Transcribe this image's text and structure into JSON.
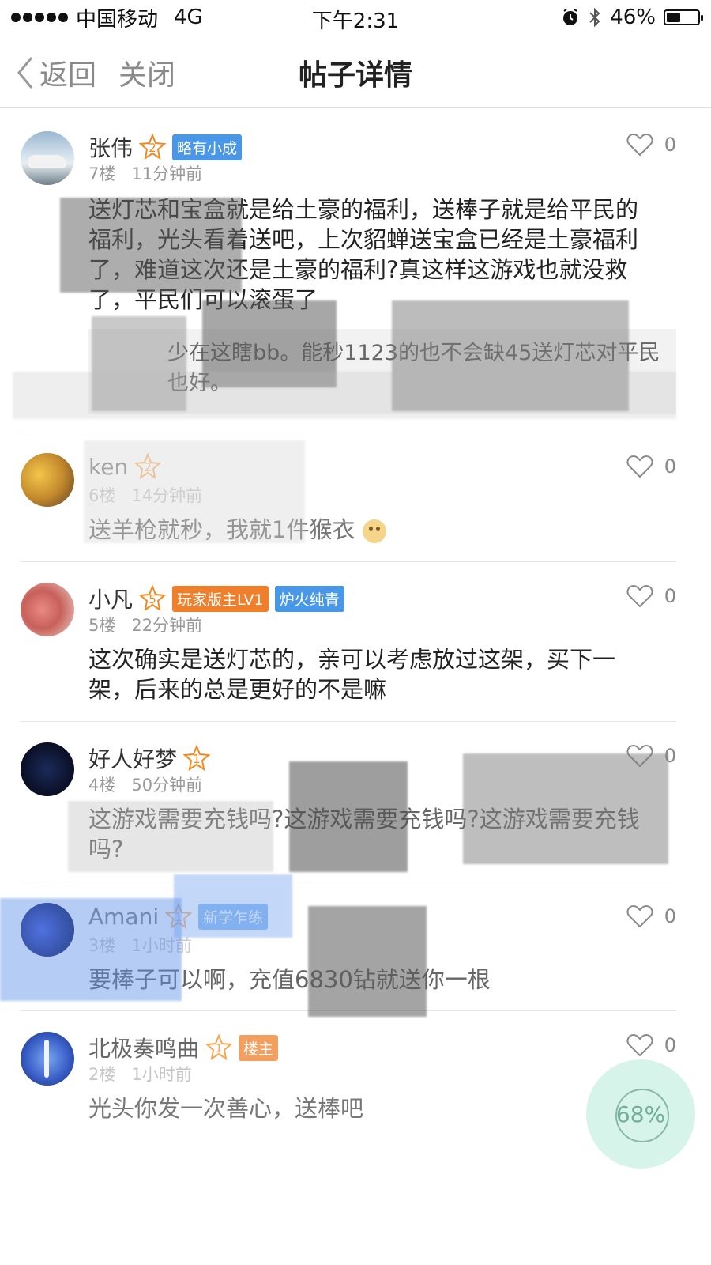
{
  "status_bar": {
    "carrier": "中国移动",
    "network": "4G",
    "time": "下午2:31",
    "battery_percent": "46%",
    "battery_level": 0.46
  },
  "nav": {
    "back_label": "返回",
    "close_label": "关闭",
    "title": "帖子详情"
  },
  "colors": {
    "accent_orange": "#f07f2b",
    "badge_blue": "#4a97e8",
    "float_button": "#c8f0e1"
  },
  "comments": [
    {
      "username": "张伟",
      "level": "2",
      "badges": [
        "略有小成"
      ],
      "floor": "7楼",
      "time": "11分钟前",
      "likes": "0",
      "content": "送灯芯和宝盒就是给土豪的福利，送棒子就是给平民的福利，光头看着送吧，上次貂蝉送宝盒已经是土豪福利了，难道这次还是土豪的福利?真这样这游戏也就没救了，平民们可以滚蛋了",
      "quote": "少在这瞎bb。能秒1123的也不会缺45送灯芯对平民也好。"
    },
    {
      "username": "ken",
      "level": "2",
      "badges": [],
      "floor": "6楼",
      "time": "14分钟前",
      "likes": "0",
      "content": "送羊枪就秒，我就1件猴衣"
    },
    {
      "username": "小凡",
      "level": "5",
      "badges": [
        "玩家版主LV1",
        "炉火纯青"
      ],
      "floor": "5楼",
      "time": "22分钟前",
      "likes": "0",
      "content": "这次确实是送灯芯的，亲可以考虑放过这架，买下一架，后来的总是更好的不是嘛"
    },
    {
      "username": "好人好梦",
      "level": "1",
      "badges": [],
      "floor": "4楼",
      "time": "50分钟前",
      "likes": "0",
      "content": "这游戏需要充钱吗?这游戏需要充钱吗?这游戏需要充钱吗?"
    },
    {
      "username": "Amani",
      "level": "1",
      "badges": [
        "新学乍练"
      ],
      "floor": "3楼",
      "time": "1小时前",
      "likes": "0",
      "content": "要棒子可以啊，充值6830钻就送你一根"
    },
    {
      "username": "北极奏鸣曲",
      "level": "1",
      "badges": [
        "楼主"
      ],
      "floor": "2楼",
      "time": "1小时前",
      "likes": "0",
      "content": "光头你发一次善心，送棒吧"
    }
  ],
  "float_button": {
    "label": "68%",
    "level": 0.68
  }
}
